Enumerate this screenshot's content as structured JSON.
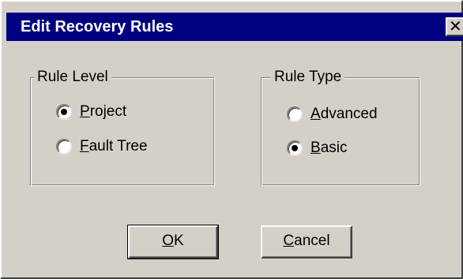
{
  "window": {
    "title": "Edit Recovery Rules",
    "close_glyph": "✕",
    "close_icon": "close-icon"
  },
  "rule_level": {
    "label": "Rule Level",
    "options": [
      {
        "mnemonic": "P",
        "rest": "roject",
        "selected": true
      },
      {
        "mnemonic": "F",
        "rest": "ault Tree",
        "selected": false
      }
    ]
  },
  "rule_type": {
    "label": "Rule Type",
    "options": [
      {
        "mnemonic": "A",
        "rest": "dvanced",
        "selected": false
      },
      {
        "mnemonic": "B",
        "rest": "asic",
        "selected": true
      }
    ]
  },
  "buttons": {
    "ok": {
      "mnemonic": "O",
      "rest": "K"
    },
    "cancel": {
      "mnemonic": "C",
      "rest": "ancel"
    }
  }
}
